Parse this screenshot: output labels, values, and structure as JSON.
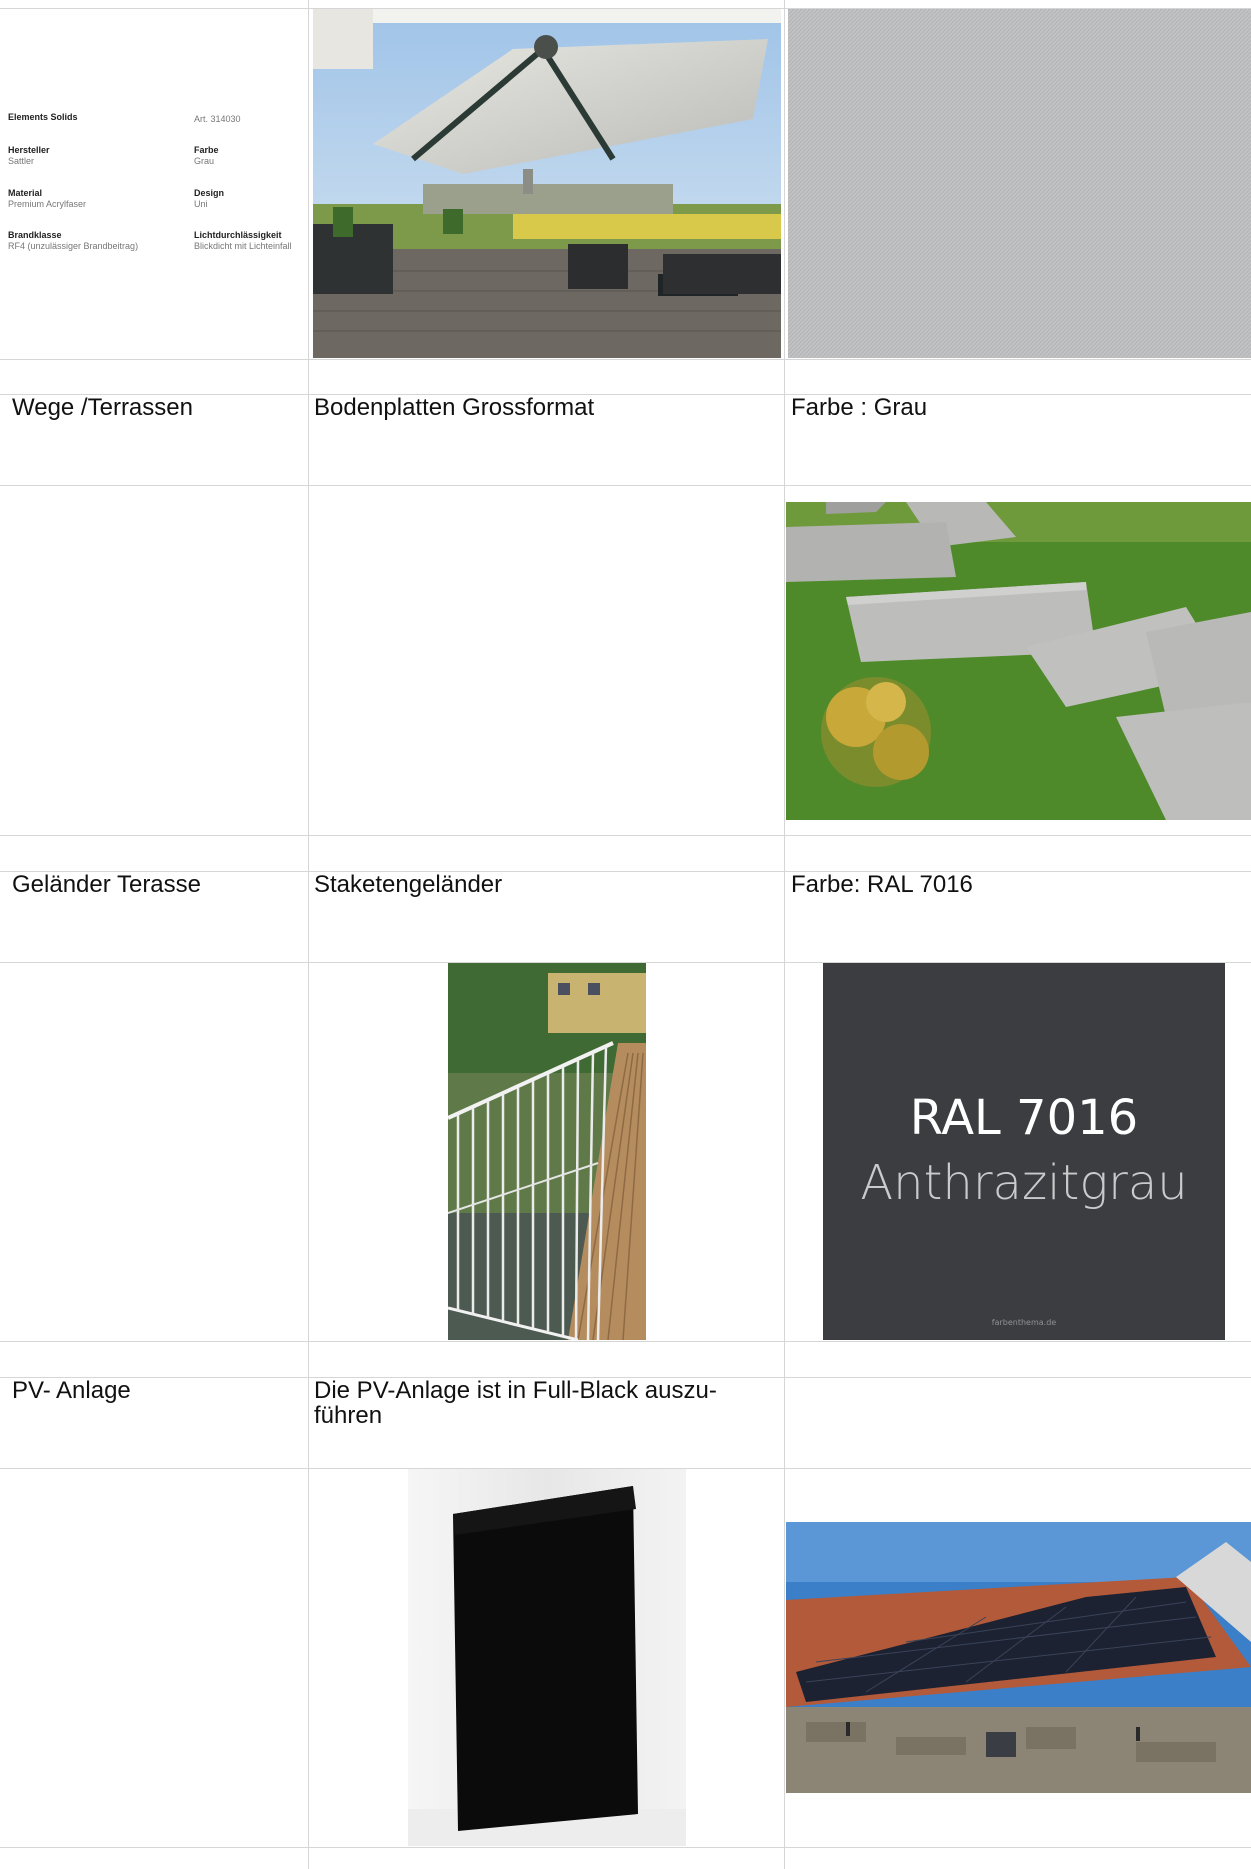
{
  "product_sheet": {
    "name": "Elements Solids",
    "article": "Art. 314030",
    "fields": [
      {
        "label": "Hersteller",
        "value": "Sattler"
      },
      {
        "label": "Farbe",
        "value": "Grau"
      },
      {
        "label": "Material",
        "value": "Premium Acrylfaser"
      },
      {
        "label": "Design",
        "value": "Uni"
      },
      {
        "label": "Brandklasse",
        "value": "RF4 (unzulässiger Brandbeitrag)"
      },
      {
        "label": "Lichtdurchlässigkeit",
        "value": "Blickdicht mit Lichteinfall"
      }
    ]
  },
  "rows": [
    {
      "category": "Wege /Terrassen",
      "description": "Bodenplatten Grossformat",
      "note": "Farbe : Grau"
    },
    {
      "category": "Geländer Terasse",
      "description": "Staketengeländer",
      "note": "Farbe: RAL 7016"
    },
    {
      "category": "PV- Anlage",
      "description_line1": "Die PV-Anlage ist in Full-Black auszu-",
      "description_line2": "führen",
      "note": ""
    }
  ],
  "ral_swatch": {
    "code": "RAL 7016",
    "name": "Anthrazitgrau",
    "source": "farbenthema.de",
    "color": "#3b3d40"
  },
  "colors": {
    "grid": "#d6d6d6",
    "fabric_grey": "#b6b8ba",
    "lawn_green": "#4f8a2a",
    "sky_blue": "#3b7fc8"
  }
}
